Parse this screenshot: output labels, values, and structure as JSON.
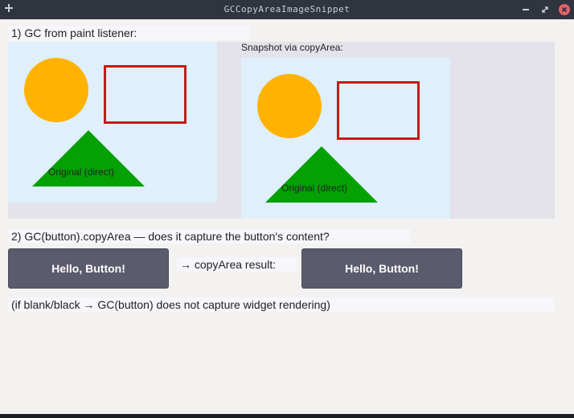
{
  "window": {
    "title": "GCCopyAreaImageSnippet"
  },
  "section1": {
    "label": "1) GC from paint listener:",
    "snapshot_label": "Snapshot via copyArea:",
    "original_caption": "Original (direct)",
    "snapshot_caption": "Original (direct)"
  },
  "section2": {
    "label": "2) GC(button).copyArea — does it capture the button's content?",
    "button_label": "Hello, Button!",
    "result_label": "→ copyArea result:",
    "result_button_label": "Hello, Button!",
    "note": "(if blank/black → GC(button) does not capture widget rendering)"
  },
  "colors": {
    "circle": "#ffb300",
    "rectangle_stroke": "#c41a1a",
    "triangle": "#04a004",
    "canvas_bg": "#dff0fc",
    "button_bg": "#5b5b6e"
  },
  "icons": {
    "pin": "plus-icon",
    "min": "minimize-icon",
    "max": "maximize-icon",
    "close": "close-icon"
  }
}
